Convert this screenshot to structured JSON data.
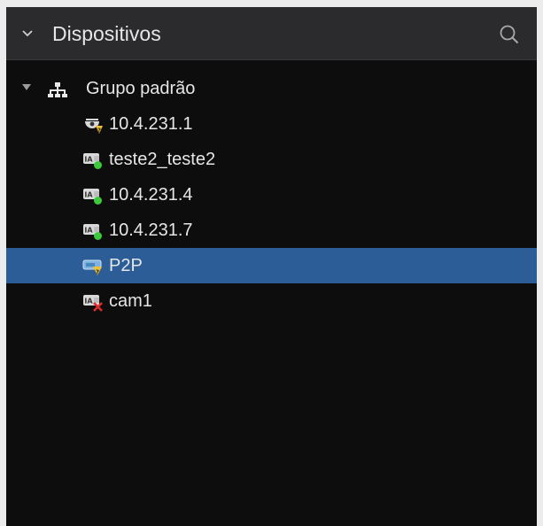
{
  "panel": {
    "title": "Dispositivos"
  },
  "tree": {
    "group": {
      "label": "Grupo padrão",
      "expanded": true,
      "icon": "network-group-icon"
    },
    "devices": [
      {
        "label": "10.4.231.1",
        "icon": "dome-camera-unknown-icon",
        "status": "unknown"
      },
      {
        "label": "teste2_teste2",
        "icon": "ia-camera-online-icon",
        "status": "online"
      },
      {
        "label": "10.4.231.4",
        "icon": "ia-camera-online-icon",
        "status": "online"
      },
      {
        "label": "10.4.231.7",
        "icon": "ia-camera-online-icon",
        "status": "online"
      },
      {
        "label": "P2P",
        "icon": "p2p-device-unknown-icon",
        "status": "unknown",
        "selected": true
      },
      {
        "label": "cam1",
        "icon": "ia-camera-offline-icon",
        "status": "offline"
      }
    ]
  },
  "colors": {
    "background": "#0d0d0e",
    "header": "#2b2b2d",
    "selection": "#2c5d96",
    "online": "#3cc93c",
    "offline": "#e02b2b",
    "unknown": "#f2c12e"
  }
}
